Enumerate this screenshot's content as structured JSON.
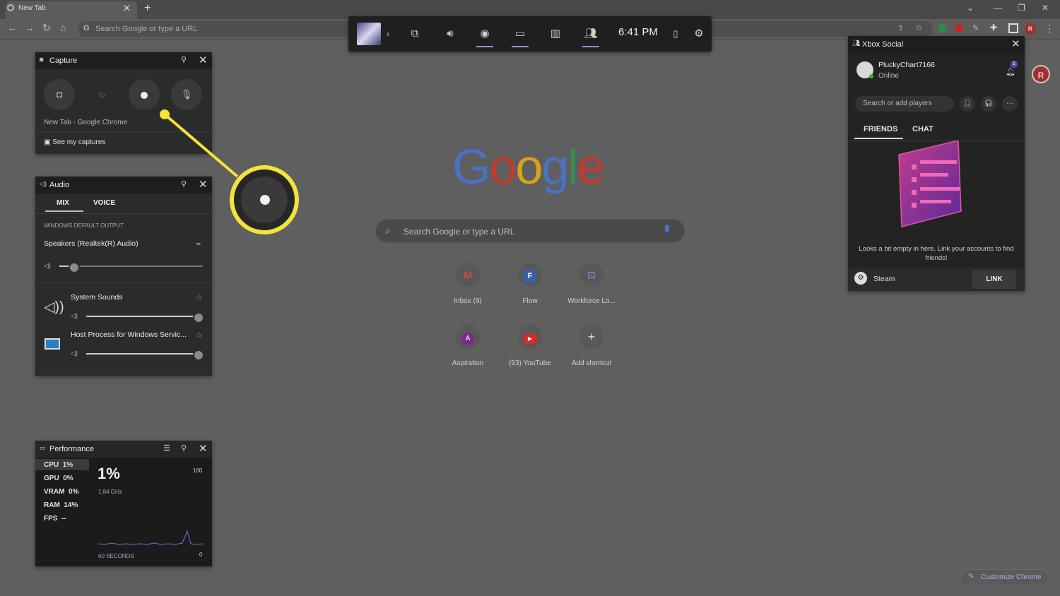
{
  "browser": {
    "tab_title": "New Tab",
    "omnibox_placeholder": "Search Google or type a URL",
    "profile_initial": "R",
    "customize_label": "Customize Chrome"
  },
  "gamebar": {
    "time": "6:41 PM"
  },
  "capture": {
    "title": "Capture",
    "target": "New Tab - Google Chrome",
    "see_captures": "See my captures"
  },
  "audio": {
    "title": "Audio",
    "tabs": [
      "MIX",
      "VOICE"
    ],
    "output_header": "WINDOWS DEFAULT OUTPUT",
    "output_device": "Speakers (Realtek(R) Audio)",
    "master_volume": 0.1,
    "apps": [
      {
        "name": "System Sounds",
        "volume": 1.0
      },
      {
        "name": "Host Process for Windows Servic...",
        "volume": 1.0
      }
    ]
  },
  "performance": {
    "title": "Performance",
    "stats": [
      {
        "label": "CPU",
        "value": "1%"
      },
      {
        "label": "GPU",
        "value": "0%"
      },
      {
        "label": "VRAM",
        "value": "0%"
      },
      {
        "label": "RAM",
        "value": "14%"
      },
      {
        "label": "FPS",
        "value": "--"
      }
    ],
    "big_value": "1%",
    "freq": "1.84 GHz",
    "max": "100",
    "min": "0",
    "window": "60 SECONDS"
  },
  "google": {
    "search_placeholder": "Search Google or type a URL",
    "shortcuts": [
      {
        "label": "Inbox (9)",
        "glyph": "M"
      },
      {
        "label": "Flow",
        "glyph": "F"
      },
      {
        "label": "Workforce Lo...",
        "glyph": "⊡"
      },
      {
        "label": "Aspiration",
        "glyph": "A"
      },
      {
        "label": "(93) YouTube",
        "glyph": "▶"
      },
      {
        "label": "Add shortcut",
        "glyph": "+"
      }
    ]
  },
  "social": {
    "title": "Xbox Social",
    "gamertag": "PluckyChart7166",
    "status": "Online",
    "notif_count": "1",
    "search_placeholder": "Search or add players",
    "tabs": [
      "FRIENDS",
      "CHAT"
    ],
    "empty_msg": "Looks a bit empty in here. Link your accounts to find friends!",
    "steam_label": "Steam",
    "link_label": "LINK"
  }
}
